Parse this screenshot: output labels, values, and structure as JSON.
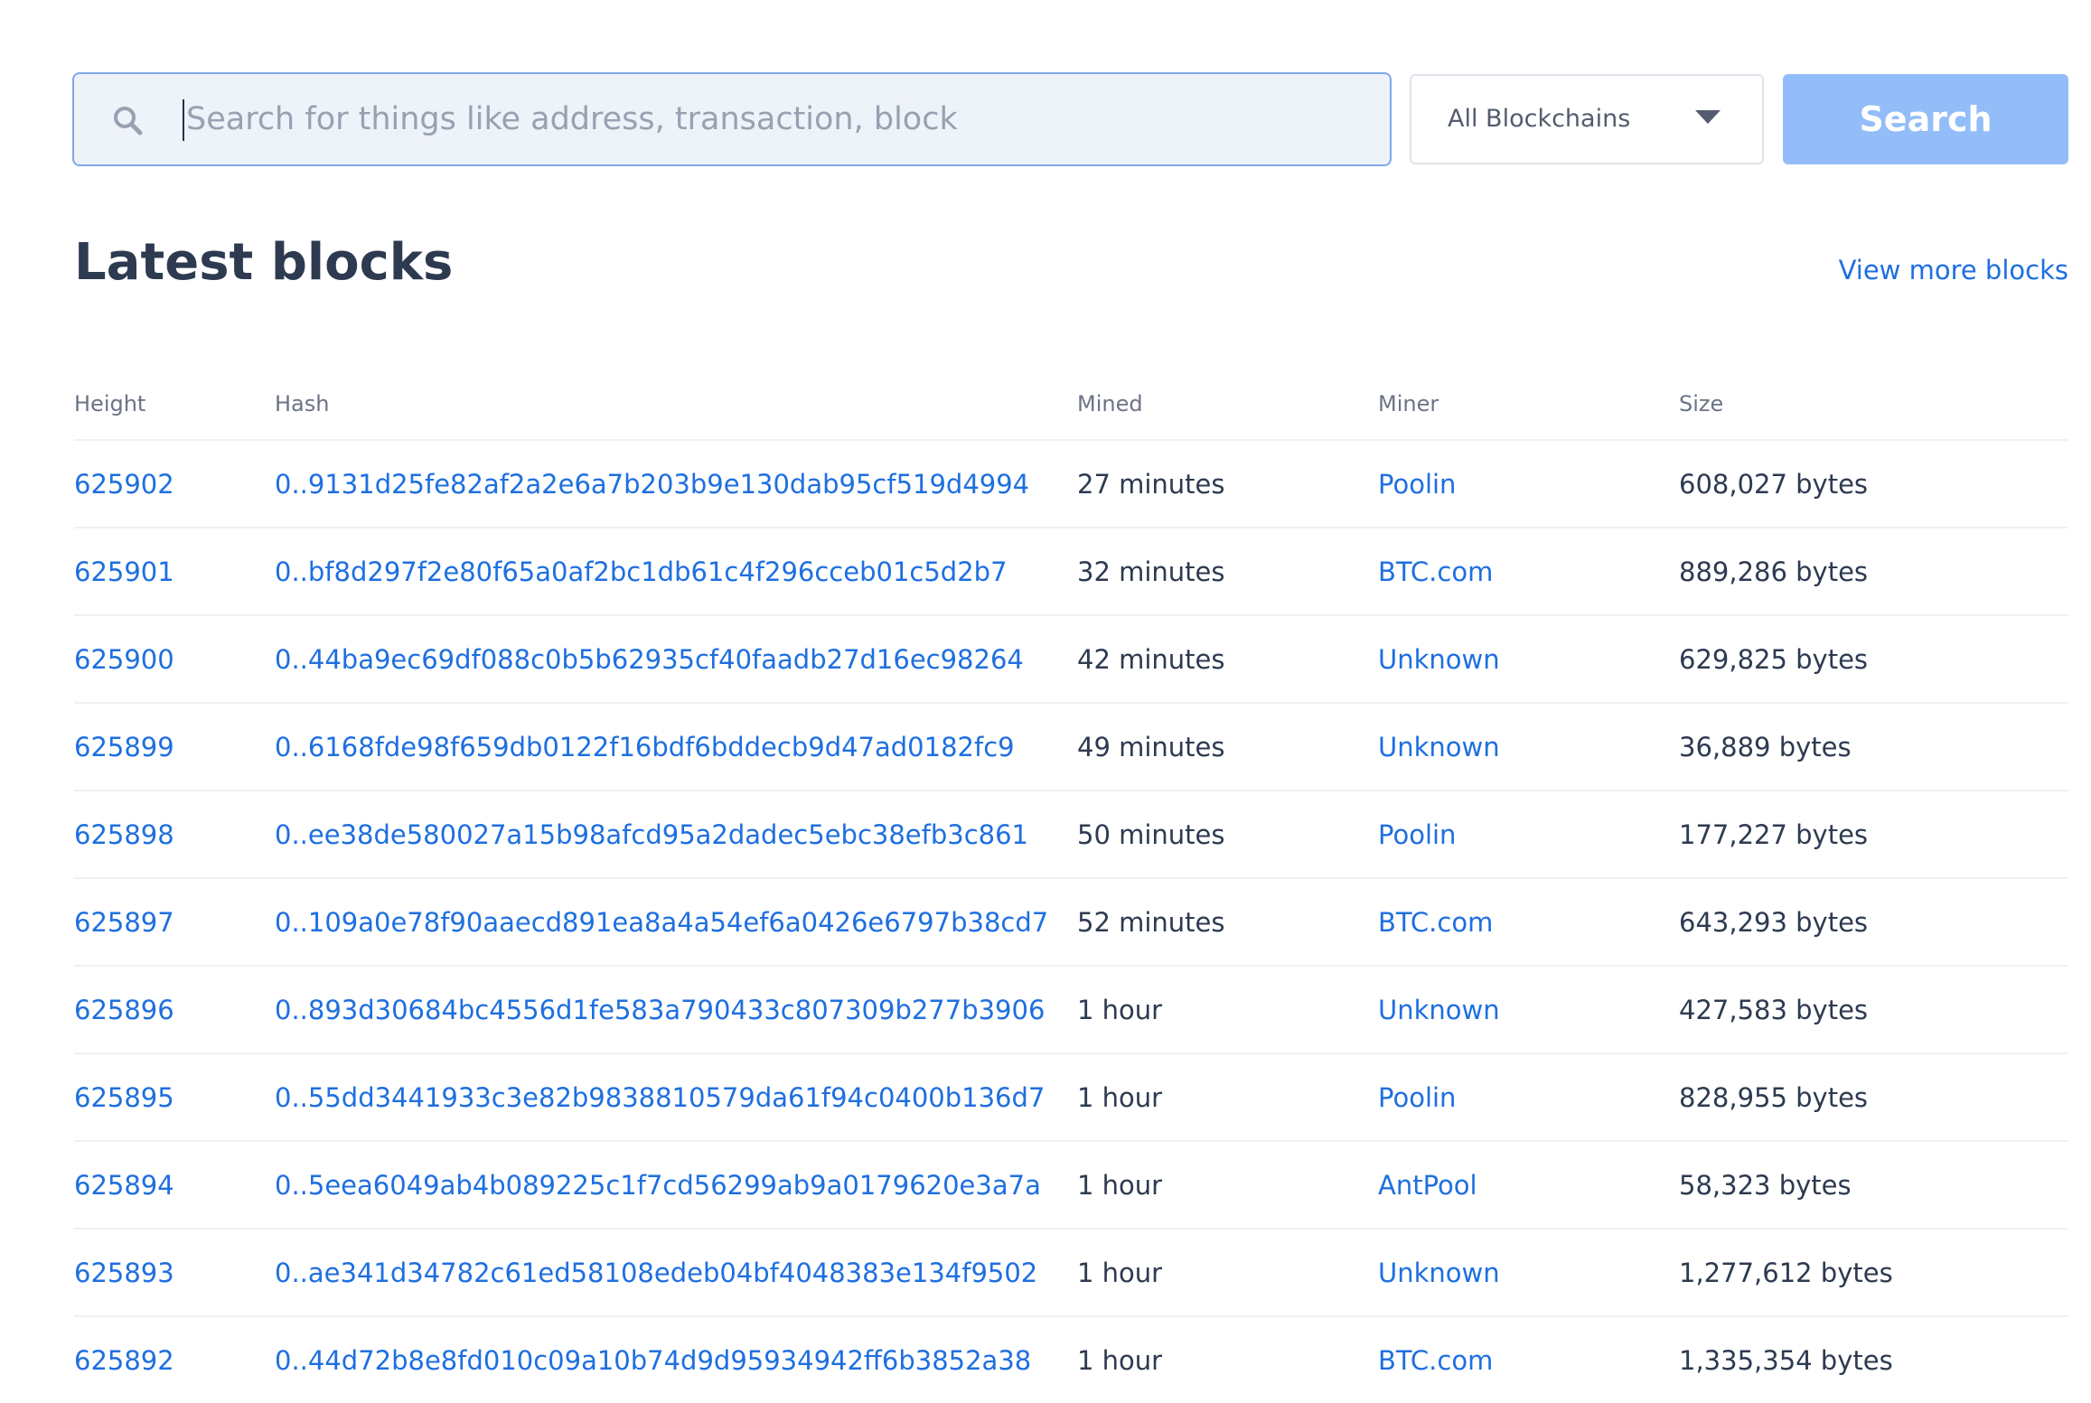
{
  "search": {
    "placeholder": "Search for things like address, transaction, block",
    "value": "",
    "chain_select": "All Blockchains",
    "button_label": "Search"
  },
  "section": {
    "title": "Latest blocks",
    "view_more": "View more blocks"
  },
  "table": {
    "headers": {
      "height": "Height",
      "hash": "Hash",
      "mined": "Mined",
      "miner": "Miner",
      "size": "Size"
    },
    "rows": [
      {
        "height": "625902",
        "hash": "0..9131d25fe82af2a2e6a7b203b9e130dab95cf519d4994",
        "mined": "27 minutes",
        "miner": "Poolin",
        "size": "608,027 bytes"
      },
      {
        "height": "625901",
        "hash": "0..bf8d297f2e80f65a0af2bc1db61c4f296cceb01c5d2b7",
        "mined": "32 minutes",
        "miner": "BTC.com",
        "size": "889,286 bytes"
      },
      {
        "height": "625900",
        "hash": "0..44ba9ec69df088c0b5b62935cf40faadb27d16ec98264",
        "mined": "42 minutes",
        "miner": "Unknown",
        "size": "629,825 bytes"
      },
      {
        "height": "625899",
        "hash": "0..6168fde98f659db0122f16bdf6bddecb9d47ad0182fc9",
        "mined": "49 minutes",
        "miner": "Unknown",
        "size": "36,889 bytes"
      },
      {
        "height": "625898",
        "hash": "0..ee38de580027a15b98afcd95a2dadec5ebc38efb3c861",
        "mined": "50 minutes",
        "miner": "Poolin",
        "size": "177,227 bytes"
      },
      {
        "height": "625897",
        "hash": "0..109a0e78f90aaecd891ea8a4a54ef6a0426e6797b38cd7",
        "mined": "52 minutes",
        "miner": "BTC.com",
        "size": "643,293 bytes"
      },
      {
        "height": "625896",
        "hash": "0..893d30684bc4556d1fe583a790433c807309b277b3906",
        "mined": "1 hour",
        "miner": "Unknown",
        "size": "427,583 bytes"
      },
      {
        "height": "625895",
        "hash": "0..55dd3441933c3e82b9838810579da61f94c0400b136d7",
        "mined": "1 hour",
        "miner": "Poolin",
        "size": "828,955 bytes"
      },
      {
        "height": "625894",
        "hash": "0..5eea6049ab4b089225c1f7cd56299ab9a0179620e3a7a",
        "mined": "1 hour",
        "miner": "AntPool",
        "size": "58,323 bytes"
      },
      {
        "height": "625893",
        "hash": "0..ae341d34782c61ed58108edeb04bf4048383e134f9502",
        "mined": "1 hour",
        "miner": "Unknown",
        "size": "1,277,612 bytes"
      },
      {
        "height": "625892",
        "hash": "0..44d72b8e8fd010c09a10b74d9d95934942ff6b3852a38",
        "mined": "1 hour",
        "miner": "BTC.com",
        "size": "1,335,354 bytes"
      }
    ]
  },
  "colors": {
    "link": "#1e6fe0",
    "search_button": "#93bdf8",
    "input_border": "#7fa8ea",
    "input_bg": "#eef2f9"
  }
}
